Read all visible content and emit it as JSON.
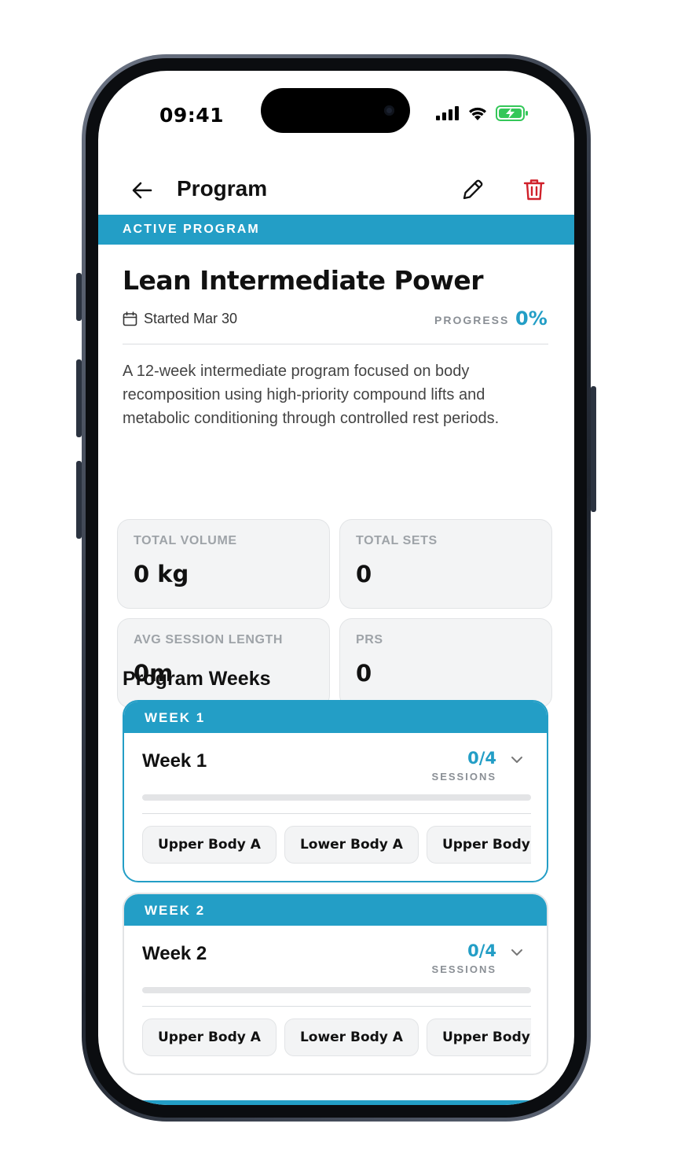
{
  "status_bar": {
    "time": "09:41"
  },
  "header": {
    "title": "Program"
  },
  "banner": {
    "label": "ACTIVE PROGRAM"
  },
  "program": {
    "name": "Lean Intermediate Power",
    "started": "Started Mar 30",
    "progress_label": "PROGRESS",
    "progress_value": "0%",
    "description": "A 12-week intermediate program focused on body recomposition using high-priority compound lifts and metabolic conditioning through controlled rest periods."
  },
  "stats": [
    {
      "label": "TOTAL VOLUME",
      "value": "0 kg"
    },
    {
      "label": "TOTAL SETS",
      "value": "0"
    },
    {
      "label": "AVG SESSION LENGTH",
      "value": "0m"
    },
    {
      "label": "PRS",
      "value": "0"
    }
  ],
  "weeks_section": {
    "title": "Program Weeks",
    "weeks": [
      {
        "header": "WEEK 1",
        "title": "Week 1",
        "count": "0/4",
        "sessions_label": "SESSIONS",
        "progress_fraction": 0,
        "sessions": [
          "Upper Body A",
          "Lower Body A",
          "Upper Body B"
        ]
      },
      {
        "header": "WEEK 2",
        "title": "Week 2",
        "count": "0/4",
        "sessions_label": "SESSIONS",
        "progress_fraction": 0,
        "sessions": [
          "Upper Body A",
          "Lower Body A",
          "Upper Body B"
        ]
      }
    ]
  },
  "colors": {
    "accent": "#239ec6",
    "danger": "#d0202a",
    "battery": "#34c759"
  }
}
